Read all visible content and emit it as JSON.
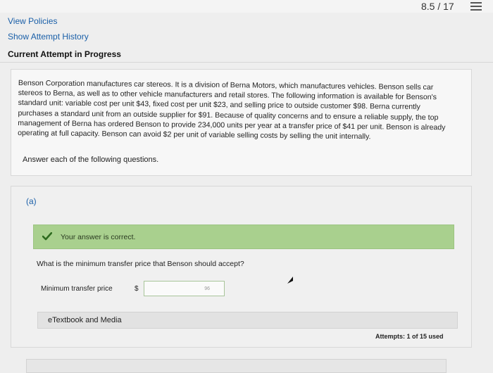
{
  "header": {
    "score": "8.5 / 17",
    "menu_icon": "list-menu-icon"
  },
  "nav": {
    "view_policies": "View Policies",
    "show_attempt_history": "Show Attempt History",
    "current_attempt": "Current Attempt in Progress"
  },
  "problem": {
    "lines": [
      "Benson Corporation manufactures car stereos. It is a division of Berna Motors, which manufactures vehicles. Benson sells car",
      "stereos to Berna, as well as to other vehicle manufacturers and retail stores. The following information is available for Benson's",
      "standard unit: variable cost per unit $43, fixed cost per unit $23, and selling price to outside customer $98. Berna currently",
      "purchases a standard unit from an outside supplier for $91. Because of quality concerns and to ensure a reliable supply, the top",
      "management of Berna has ordered Benson to provide 234,000 units per year at a transfer price of $41 per unit. Benson is already",
      "operating at full capacity. Benson can avoid $2 per unit of variable selling costs by selling the unit internally."
    ],
    "instruction": "Answer each of the following questions."
  },
  "part_a": {
    "label": "(a)",
    "status_message": "Your answer is correct.",
    "question": "What is the minimum transfer price that Benson should accept?",
    "field_label": "Minimum transfer price",
    "currency": "$",
    "answer_value": "96",
    "etextbook": "eTextbook and Media",
    "attempts": "Attempts: 1 of 15 used"
  },
  "colors": {
    "link": "#1a5fa8",
    "correct_bg": "#a9d08e",
    "check": "#2e6b1f"
  }
}
